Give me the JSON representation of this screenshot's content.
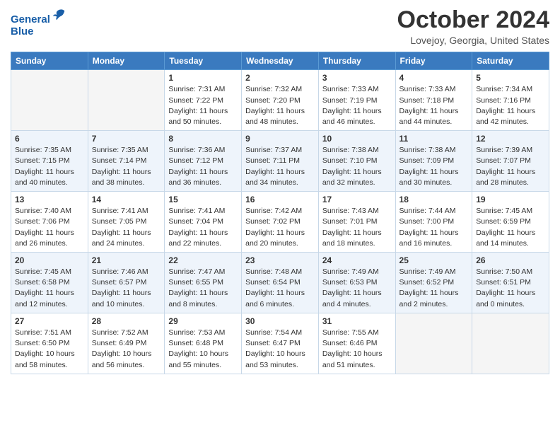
{
  "header": {
    "logo_line1": "General",
    "logo_line2": "Blue",
    "month": "October 2024",
    "location": "Lovejoy, Georgia, United States"
  },
  "weekdays": [
    "Sunday",
    "Monday",
    "Tuesday",
    "Wednesday",
    "Thursday",
    "Friday",
    "Saturday"
  ],
  "weeks": [
    [
      {
        "day": "",
        "sunrise": "",
        "sunset": "",
        "daylight": ""
      },
      {
        "day": "",
        "sunrise": "",
        "sunset": "",
        "daylight": ""
      },
      {
        "day": "1",
        "sunrise": "Sunrise: 7:31 AM",
        "sunset": "Sunset: 7:22 PM",
        "daylight": "Daylight: 11 hours and 50 minutes."
      },
      {
        "day": "2",
        "sunrise": "Sunrise: 7:32 AM",
        "sunset": "Sunset: 7:20 PM",
        "daylight": "Daylight: 11 hours and 48 minutes."
      },
      {
        "day": "3",
        "sunrise": "Sunrise: 7:33 AM",
        "sunset": "Sunset: 7:19 PM",
        "daylight": "Daylight: 11 hours and 46 minutes."
      },
      {
        "day": "4",
        "sunrise": "Sunrise: 7:33 AM",
        "sunset": "Sunset: 7:18 PM",
        "daylight": "Daylight: 11 hours and 44 minutes."
      },
      {
        "day": "5",
        "sunrise": "Sunrise: 7:34 AM",
        "sunset": "Sunset: 7:16 PM",
        "daylight": "Daylight: 11 hours and 42 minutes."
      }
    ],
    [
      {
        "day": "6",
        "sunrise": "Sunrise: 7:35 AM",
        "sunset": "Sunset: 7:15 PM",
        "daylight": "Daylight: 11 hours and 40 minutes."
      },
      {
        "day": "7",
        "sunrise": "Sunrise: 7:35 AM",
        "sunset": "Sunset: 7:14 PM",
        "daylight": "Daylight: 11 hours and 38 minutes."
      },
      {
        "day": "8",
        "sunrise": "Sunrise: 7:36 AM",
        "sunset": "Sunset: 7:12 PM",
        "daylight": "Daylight: 11 hours and 36 minutes."
      },
      {
        "day": "9",
        "sunrise": "Sunrise: 7:37 AM",
        "sunset": "Sunset: 7:11 PM",
        "daylight": "Daylight: 11 hours and 34 minutes."
      },
      {
        "day": "10",
        "sunrise": "Sunrise: 7:38 AM",
        "sunset": "Sunset: 7:10 PM",
        "daylight": "Daylight: 11 hours and 32 minutes."
      },
      {
        "day": "11",
        "sunrise": "Sunrise: 7:38 AM",
        "sunset": "Sunset: 7:09 PM",
        "daylight": "Daylight: 11 hours and 30 minutes."
      },
      {
        "day": "12",
        "sunrise": "Sunrise: 7:39 AM",
        "sunset": "Sunset: 7:07 PM",
        "daylight": "Daylight: 11 hours and 28 minutes."
      }
    ],
    [
      {
        "day": "13",
        "sunrise": "Sunrise: 7:40 AM",
        "sunset": "Sunset: 7:06 PM",
        "daylight": "Daylight: 11 hours and 26 minutes."
      },
      {
        "day": "14",
        "sunrise": "Sunrise: 7:41 AM",
        "sunset": "Sunset: 7:05 PM",
        "daylight": "Daylight: 11 hours and 24 minutes."
      },
      {
        "day": "15",
        "sunrise": "Sunrise: 7:41 AM",
        "sunset": "Sunset: 7:04 PM",
        "daylight": "Daylight: 11 hours and 22 minutes."
      },
      {
        "day": "16",
        "sunrise": "Sunrise: 7:42 AM",
        "sunset": "Sunset: 7:02 PM",
        "daylight": "Daylight: 11 hours and 20 minutes."
      },
      {
        "day": "17",
        "sunrise": "Sunrise: 7:43 AM",
        "sunset": "Sunset: 7:01 PM",
        "daylight": "Daylight: 11 hours and 18 minutes."
      },
      {
        "day": "18",
        "sunrise": "Sunrise: 7:44 AM",
        "sunset": "Sunset: 7:00 PM",
        "daylight": "Daylight: 11 hours and 16 minutes."
      },
      {
        "day": "19",
        "sunrise": "Sunrise: 7:45 AM",
        "sunset": "Sunset: 6:59 PM",
        "daylight": "Daylight: 11 hours and 14 minutes."
      }
    ],
    [
      {
        "day": "20",
        "sunrise": "Sunrise: 7:45 AM",
        "sunset": "Sunset: 6:58 PM",
        "daylight": "Daylight: 11 hours and 12 minutes."
      },
      {
        "day": "21",
        "sunrise": "Sunrise: 7:46 AM",
        "sunset": "Sunset: 6:57 PM",
        "daylight": "Daylight: 11 hours and 10 minutes."
      },
      {
        "day": "22",
        "sunrise": "Sunrise: 7:47 AM",
        "sunset": "Sunset: 6:55 PM",
        "daylight": "Daylight: 11 hours and 8 minutes."
      },
      {
        "day": "23",
        "sunrise": "Sunrise: 7:48 AM",
        "sunset": "Sunset: 6:54 PM",
        "daylight": "Daylight: 11 hours and 6 minutes."
      },
      {
        "day": "24",
        "sunrise": "Sunrise: 7:49 AM",
        "sunset": "Sunset: 6:53 PM",
        "daylight": "Daylight: 11 hours and 4 minutes."
      },
      {
        "day": "25",
        "sunrise": "Sunrise: 7:49 AM",
        "sunset": "Sunset: 6:52 PM",
        "daylight": "Daylight: 11 hours and 2 minutes."
      },
      {
        "day": "26",
        "sunrise": "Sunrise: 7:50 AM",
        "sunset": "Sunset: 6:51 PM",
        "daylight": "Daylight: 11 hours and 0 minutes."
      }
    ],
    [
      {
        "day": "27",
        "sunrise": "Sunrise: 7:51 AM",
        "sunset": "Sunset: 6:50 PM",
        "daylight": "Daylight: 10 hours and 58 minutes."
      },
      {
        "day": "28",
        "sunrise": "Sunrise: 7:52 AM",
        "sunset": "Sunset: 6:49 PM",
        "daylight": "Daylight: 10 hours and 56 minutes."
      },
      {
        "day": "29",
        "sunrise": "Sunrise: 7:53 AM",
        "sunset": "Sunset: 6:48 PM",
        "daylight": "Daylight: 10 hours and 55 minutes."
      },
      {
        "day": "30",
        "sunrise": "Sunrise: 7:54 AM",
        "sunset": "Sunset: 6:47 PM",
        "daylight": "Daylight: 10 hours and 53 minutes."
      },
      {
        "day": "31",
        "sunrise": "Sunrise: 7:55 AM",
        "sunset": "Sunset: 6:46 PM",
        "daylight": "Daylight: 10 hours and 51 minutes."
      },
      {
        "day": "",
        "sunrise": "",
        "sunset": "",
        "daylight": ""
      },
      {
        "day": "",
        "sunrise": "",
        "sunset": "",
        "daylight": ""
      }
    ]
  ]
}
